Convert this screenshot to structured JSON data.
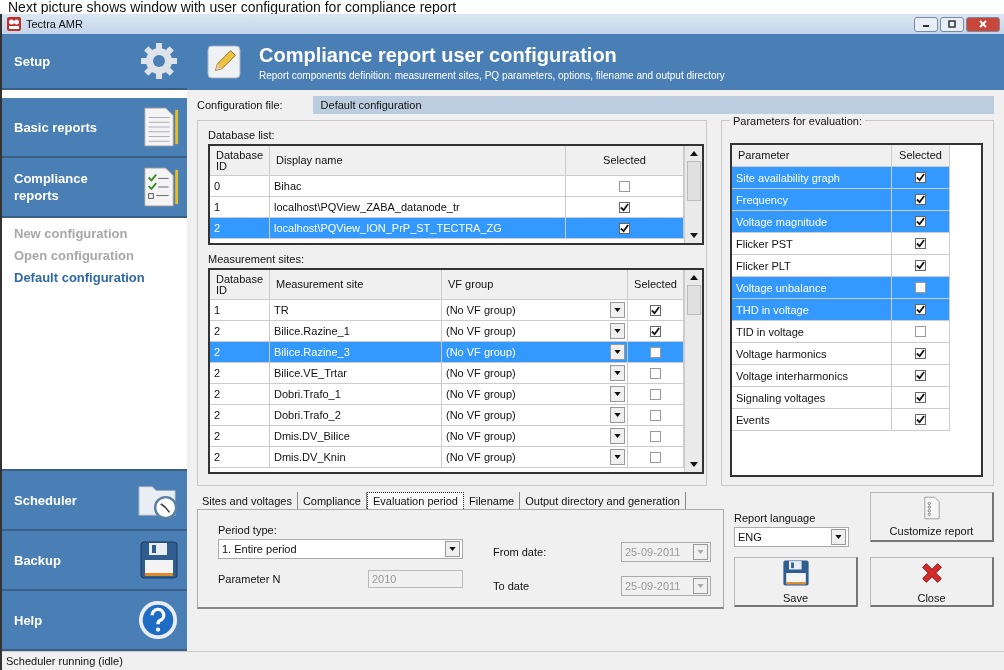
{
  "caption": "Next picture shows window with user configuration for compliance report",
  "window": {
    "title": "Tectra AMR"
  },
  "sidebar": {
    "sections": [
      {
        "label": "Setup"
      },
      {
        "label": "Basic reports"
      },
      {
        "label": "Compliance reports"
      }
    ],
    "sub_items": [
      {
        "label": "New configuration",
        "disabled": true,
        "selected": false
      },
      {
        "label": "Open configuration",
        "disabled": true,
        "selected": false
      },
      {
        "label": "Default configuration",
        "disabled": false,
        "selected": true
      }
    ],
    "bottom_sections": [
      {
        "label": "Scheduler"
      },
      {
        "label": "Backup"
      },
      {
        "label": "Help"
      }
    ]
  },
  "header": {
    "title": "Compliance report user configuration",
    "subtitle": "Report components definition: measurement sites, PQ parameters, options, filename and output directory"
  },
  "config_file": {
    "label": "Configuration file:",
    "value": "Default configuration"
  },
  "database_list": {
    "label": "Database list:",
    "columns": [
      "Database ID",
      "Display name",
      "Selected"
    ],
    "rows": [
      {
        "id": "0",
        "name": "Bihac",
        "selected": false,
        "checked": false
      },
      {
        "id": "1",
        "name": "localhost\\PQView_ZABA_datanode_tr",
        "selected": false,
        "checked": true
      },
      {
        "id": "2",
        "name": "localhost\\PQView_ION_PrP_ST_TECTRA_ZG",
        "selected": true,
        "checked": true
      }
    ]
  },
  "measurement_sites": {
    "label": "Measurement sites:",
    "columns": [
      "Database ID",
      "Measurement site",
      "VF group",
      "Selected"
    ],
    "rows": [
      {
        "id": "1",
        "site": "TR",
        "vf_group": "(No VF group)",
        "selected": false,
        "checked": true
      },
      {
        "id": "2",
        "site": "Bilice.Razine_1",
        "vf_group": "(No VF group)",
        "selected": false,
        "checked": true
      },
      {
        "id": "2",
        "site": "Bilice.Razine_3",
        "vf_group": "(No VF group)",
        "selected": true,
        "checked": false
      },
      {
        "id": "2",
        "site": "Bilice.VE_Trtar",
        "vf_group": "(No VF group)",
        "selected": false,
        "checked": false
      },
      {
        "id": "2",
        "site": "Dobri.Trafo_1",
        "vf_group": "(No VF group)",
        "selected": false,
        "checked": false
      },
      {
        "id": "2",
        "site": "Dobri.Trafo_2",
        "vf_group": "(No VF group)",
        "selected": false,
        "checked": false
      },
      {
        "id": "2",
        "site": "Dmis.DV_Bilice",
        "vf_group": "(No VF group)",
        "selected": false,
        "checked": false
      },
      {
        "id": "2",
        "site": "Dmis.DV_Knin",
        "vf_group": "(No VF group)",
        "selected": false,
        "checked": false
      }
    ]
  },
  "parameters": {
    "label": "Parameters for evaluation:",
    "columns": [
      "Parameter",
      "Selected"
    ],
    "rows": [
      {
        "name": "Site availability graph",
        "selected": true,
        "checked": true
      },
      {
        "name": "Frequency",
        "selected": true,
        "checked": true
      },
      {
        "name": "Voltage magnitude",
        "selected": true,
        "checked": true
      },
      {
        "name": "Flicker PST",
        "selected": false,
        "checked": true
      },
      {
        "name": "Flicker PLT",
        "selected": false,
        "checked": true
      },
      {
        "name": "Voltage unbalance",
        "selected": true,
        "checked": false
      },
      {
        "name": "THD in voltage",
        "selected": true,
        "checked": true
      },
      {
        "name": "TID in voltage",
        "selected": false,
        "checked": false
      },
      {
        "name": "Voltage harmonics",
        "selected": false,
        "checked": true
      },
      {
        "name": "Voltage interharmonics",
        "selected": false,
        "checked": true
      },
      {
        "name": "Signaling voltages",
        "selected": false,
        "checked": true
      },
      {
        "name": "Events",
        "selected": false,
        "checked": true
      }
    ]
  },
  "tabs": [
    {
      "label": "Sites and voltages",
      "selected": false
    },
    {
      "label": "Compliance",
      "selected": false
    },
    {
      "label": "Evaluation period",
      "selected": true
    },
    {
      "label": "Filename",
      "selected": false
    },
    {
      "label": "Output directory and generation",
      "selected": false
    }
  ],
  "evaluation_period": {
    "period_type": {
      "label": "Period type:",
      "value": "1. Entire period"
    },
    "parameter_n": {
      "label": "Parameter N",
      "value": "2010",
      "disabled": true
    },
    "from_date": {
      "label": "From date:",
      "value": "25-09-2011",
      "disabled": true
    },
    "to_date": {
      "label": "To date",
      "value": "25-09-2011",
      "disabled": true
    }
  },
  "report_language": {
    "label": "Report language",
    "value": "ENG"
  },
  "buttons": {
    "customize": "Customize report",
    "save": "Save",
    "close": "Close"
  },
  "status_bar": "Scheduler running (idle)"
}
